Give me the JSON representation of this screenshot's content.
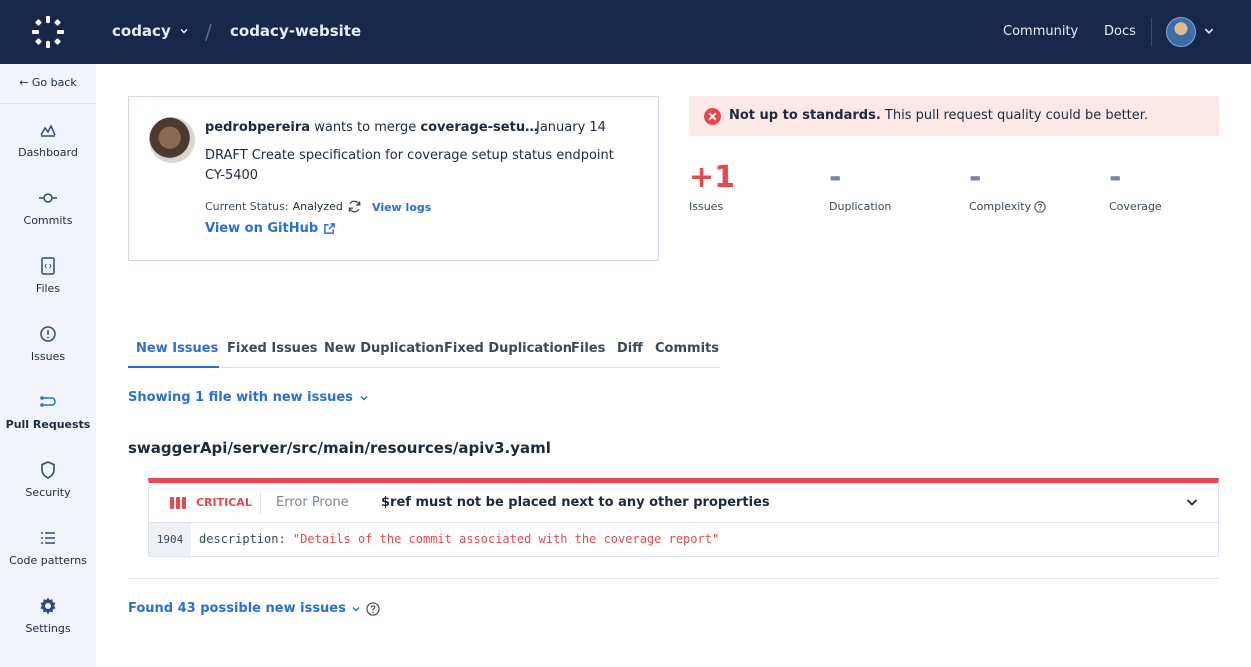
{
  "header": {
    "org": "codacy",
    "separator": "/",
    "repo": "codacy-website",
    "links": [
      "Community",
      "Docs"
    ]
  },
  "sidebar": {
    "go_back": "← Go back",
    "items": [
      {
        "label": "Dashboard",
        "icon": "dashboard-icon"
      },
      {
        "label": "Commits",
        "icon": "commit-icon"
      },
      {
        "label": "Files",
        "icon": "file-icon"
      },
      {
        "label": "Issues",
        "icon": "issues-icon"
      },
      {
        "label": "Pull Requests",
        "icon": "pull-request-icon",
        "active": true
      },
      {
        "label": "Security",
        "icon": "shield-icon"
      },
      {
        "label": "Code patterns",
        "icon": "list-icon"
      },
      {
        "label": "Settings",
        "icon": "gear-icon"
      }
    ]
  },
  "pr": {
    "author": "pedrobpereira",
    "action": "wants to merge",
    "branch": "coverage-setu…",
    "date": "January 14",
    "title": "DRAFT Create specification for coverage setup status endpoint CY-5400",
    "status_label": "Current Status:",
    "status_value": "Analyzed",
    "view_logs": "View logs",
    "github": "View on GitHub"
  },
  "standards": {
    "bold": "Not up to standards.",
    "text": "This pull request quality could be better.",
    "color": "#e5494f"
  },
  "metrics": [
    {
      "value": "+1",
      "label": "Issues"
    },
    {
      "value": "-",
      "label": "Duplication"
    },
    {
      "value": "-",
      "label": "Complexity"
    },
    {
      "value": "-",
      "label": "Coverage"
    }
  ],
  "tabs": [
    "New Issues",
    "Fixed Issues",
    "New Duplication",
    "Fixed Duplication",
    "Files",
    "Diff",
    "Commits"
  ],
  "showing": "Showing 1 file with new issues",
  "file_path": "swaggerApi/server/src/main/resources/apiv3.yaml",
  "issue": {
    "severity": "CRITICAL",
    "category": "Error Prone",
    "message": "$ref must not be placed next to any other properties",
    "line_number": "1904",
    "code_key": "description: ",
    "code_string": "\"Details of the commit associated with the coverage report\""
  },
  "found": "Found 43 possible new issues",
  "colors": {
    "accent": "#2a6fd6",
    "navbar": "#17284a",
    "critical": "#e5494f"
  }
}
